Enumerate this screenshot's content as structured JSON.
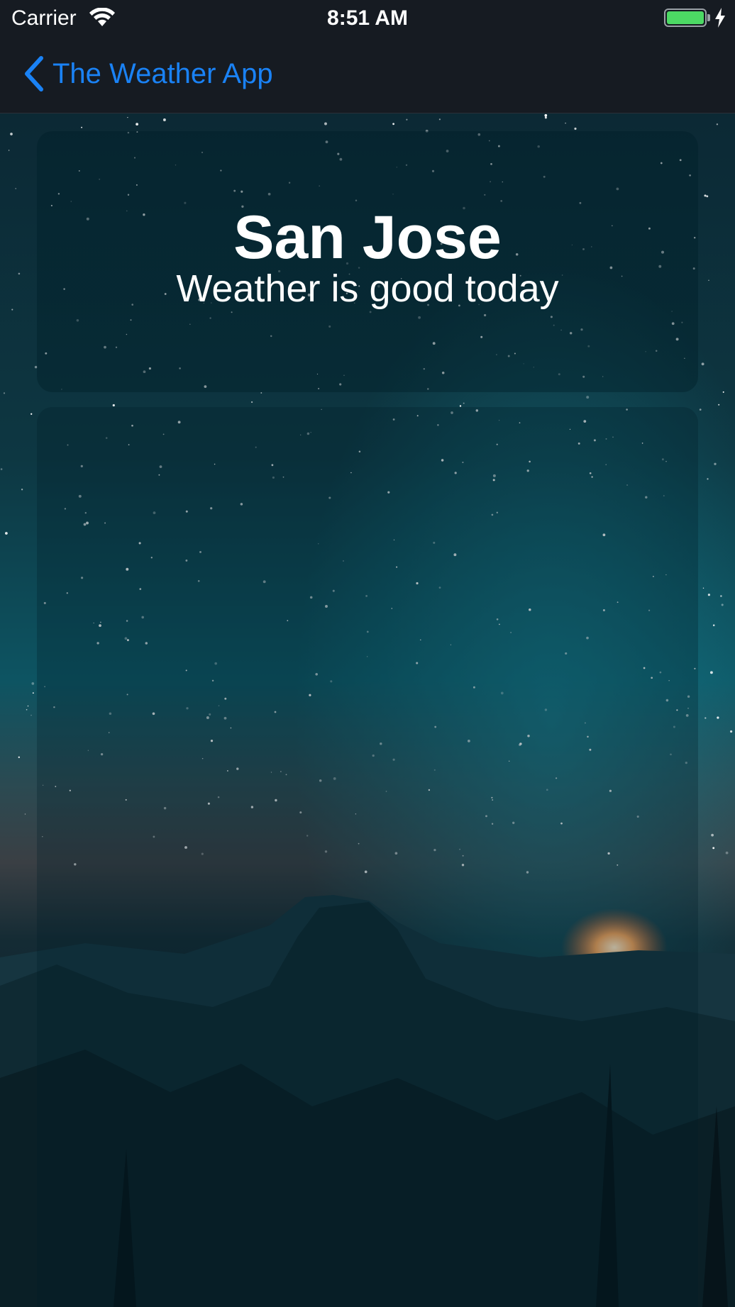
{
  "status_bar": {
    "carrier": "Carrier",
    "time": "8:51 AM"
  },
  "nav": {
    "back_label": "The Weather App"
  },
  "weather": {
    "city": "San Jose",
    "summary": "Weather is good today"
  },
  "colors": {
    "accent": "#1a82f5",
    "bar_background": "#161b22",
    "battery": "#4cd964"
  },
  "icons": {
    "wifi": "wifi-icon",
    "battery": "battery-icon",
    "charging": "charging-bolt-icon",
    "back": "chevron-left-icon"
  }
}
